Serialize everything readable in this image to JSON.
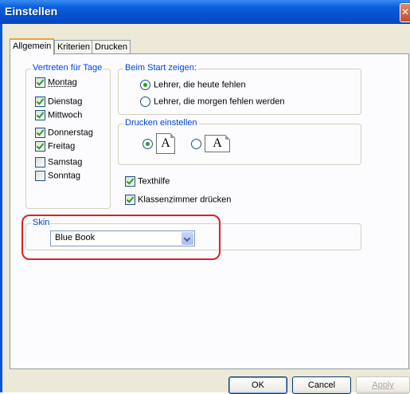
{
  "window": {
    "title": "Einstellen",
    "close_glyph": "✕"
  },
  "tabs": [
    {
      "label": "Allgemein"
    },
    {
      "label": "Kriterien"
    },
    {
      "label": "Drucken"
    }
  ],
  "days_group": {
    "legend": "Vertreten für Tage",
    "items": [
      {
        "label": "Montag",
        "checked": true
      },
      {
        "label": "Dienstag",
        "checked": true
      },
      {
        "label": "Mittwoch",
        "checked": true
      },
      {
        "label": "Donnerstag",
        "checked": true
      },
      {
        "label": "Freitag",
        "checked": true
      },
      {
        "label": "Samstag",
        "checked": false
      },
      {
        "label": "Sonntag",
        "checked": false
      }
    ]
  },
  "start_group": {
    "legend": "Beim Start zeigen:",
    "options": [
      {
        "label": "Lehrer, die heute fehlen",
        "selected": true
      },
      {
        "label": "Lehrer, die morgen fehlen werden",
        "selected": false
      }
    ]
  },
  "print_group": {
    "legend": "Drucken einstellen",
    "page_glyph": "A",
    "portrait_selected": true,
    "landscape_selected": false
  },
  "options": {
    "texthilfe": "Texthilfe",
    "klassenzimmer": "Klassenzimmer drücken"
  },
  "skin_group": {
    "legend": "Skin",
    "value": "Blue Book"
  },
  "buttons": {
    "ok": "OK",
    "cancel": "Cancel",
    "apply": "Apply"
  },
  "colors": {
    "highlight": "#e02020",
    "legend_text": "#0046d5",
    "check_mark": "#21a121"
  }
}
